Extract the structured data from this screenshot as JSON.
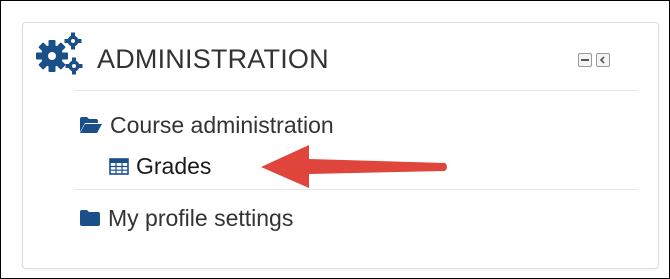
{
  "block": {
    "title": "ADMINISTRATION",
    "header_icon": "gears-icon",
    "controls": [
      {
        "name": "minimize-icon"
      },
      {
        "name": "dock-icon"
      }
    ]
  },
  "tree": {
    "course_admin": {
      "label": "Course administration",
      "icon": "folder-open-icon"
    },
    "grades": {
      "label": "Grades",
      "icon": "table-icon"
    },
    "profile_settings": {
      "label": "My profile settings",
      "icon": "folder-icon"
    }
  },
  "annotation": {
    "type": "arrow",
    "color": "#e0453b",
    "points_to": "Grades"
  },
  "colors": {
    "icon_blue": "#1a4f8a",
    "text": "#333333",
    "border": "#dddddd",
    "arrow": "#e0453b"
  }
}
